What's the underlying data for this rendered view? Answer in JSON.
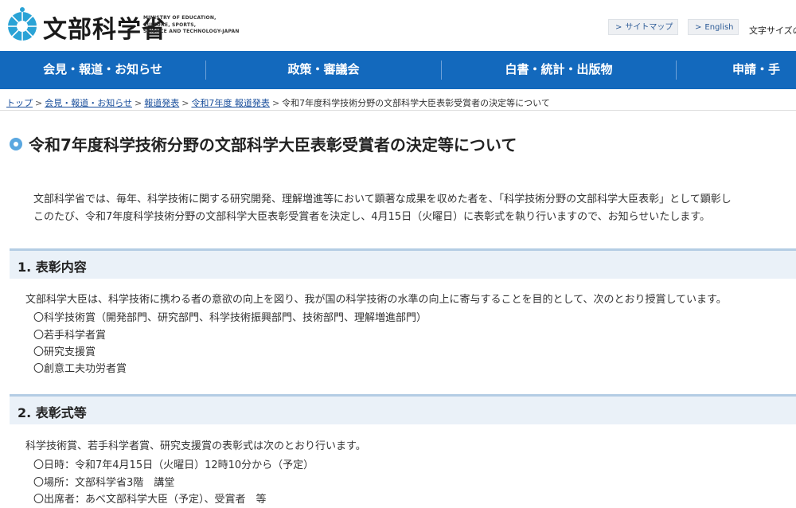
{
  "header": {
    "logo_text": "文部科学省",
    "logo_en": "MINISTRY OF EDUCATION,\nCULTURE, SPORTS,\nSCIENCE AND TECHNOLOGY-JAPAN",
    "sitemap_label": "サイトマップ",
    "english_label": "English",
    "extra_text": "文字サイズの"
  },
  "nav": {
    "items": [
      "会見・報道・お知らせ",
      "政策・審議会",
      "白書・統計・出版物",
      "申請・手"
    ]
  },
  "breadcrumb": {
    "items": [
      "トップ",
      "会見・報道・お知らせ",
      "報道発表",
      "令和7年度 報道発表"
    ],
    "current": "令和7年度科学技術分野の文部科学大臣表彰受賞者の決定等について"
  },
  "page": {
    "title": "令和7年度科学技術分野の文部科学大臣表彰受賞者の決定等について",
    "intro_1": "文部科学省では、毎年、科学技術に関する研究開発、理解増進等において顕著な成果を収めた者を、「科学技術分野の文部科学大臣表彰」として顕彰し",
    "intro_2": "このたび、令和7年度科学技術分野の文部科学大臣表彰受賞者を決定し、4月15日（火曜日）に表彰式を執り行いますので、お知らせいたします。"
  },
  "section1": {
    "heading": "1. 表彰内容",
    "text": "文部科学大臣は、科学技術に携わる者の意欲の向上を図り、我が国の科学技術の水準の向上に寄与することを目的として、次のとおり授賞しています。",
    "items": [
      "〇科学技術賞（開発部門、研究部門、科学技術振興部門、技術部門、理解増進部門）",
      "〇若手科学者賞",
      "〇研究支援賞",
      "〇創意工夫功労者賞"
    ]
  },
  "section2": {
    "heading": "2. 表彰式等",
    "text": "科学技術賞、若手科学者賞、研究支援賞の表彰式は次のとおり行います。",
    "items": [
      "〇日時：令和7年4月15日（火曜日）12時10分から（予定）",
      "〇場所：文部科学省3階　講堂",
      "〇出席者：あべ文部科学大臣（予定）、受賞者　等"
    ]
  },
  "colors": {
    "nav_bg": "#1369bd",
    "section_bg": "#eaf1f8",
    "title_icon": "#5aa7e0",
    "link": "#1a4f9c"
  }
}
